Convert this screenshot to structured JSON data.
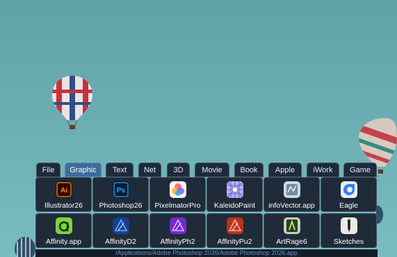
{
  "tabs": [
    {
      "label": "File"
    },
    {
      "label": "Graphic"
    },
    {
      "label": "Text"
    },
    {
      "label": "Net"
    },
    {
      "label": "3D"
    },
    {
      "label": "Movie"
    },
    {
      "label": "Book"
    },
    {
      "label": "Apple"
    },
    {
      "label": "iWork"
    },
    {
      "label": "Game"
    }
  ],
  "active_tab": "Graphic",
  "apps": [
    {
      "label": "Illustrator26",
      "icon": "illustrator-icon"
    },
    {
      "label": "Photoshop26",
      "icon": "photoshop-icon"
    },
    {
      "label": "PixelmatorPro",
      "icon": "pixelmator-icon"
    },
    {
      "label": "KaleidoPaint",
      "icon": "kaleidopaint-icon"
    },
    {
      "label": "infoVector.app",
      "icon": "infovector-icon"
    },
    {
      "label": "Eagle",
      "icon": "eagle-icon"
    },
    {
      "label": "Affinity.app",
      "icon": "affinity-icon"
    },
    {
      "label": "AffinityD2",
      "icon": "affinity-designer-icon"
    },
    {
      "label": "AffinityPh2",
      "icon": "affinity-photo-icon"
    },
    {
      "label": "AffinityPu2",
      "icon": "affinity-publisher-icon"
    },
    {
      "label": "ArtRage6",
      "icon": "artrage-icon"
    },
    {
      "label": "Sketches",
      "icon": "sketches-icon"
    }
  ],
  "icon_texts": {
    "illustrator": "Ai",
    "photoshop": "Ps"
  },
  "path_text": "/Applications/Adobe Photoshop 2026/Adobe Photoshop 2026.app"
}
